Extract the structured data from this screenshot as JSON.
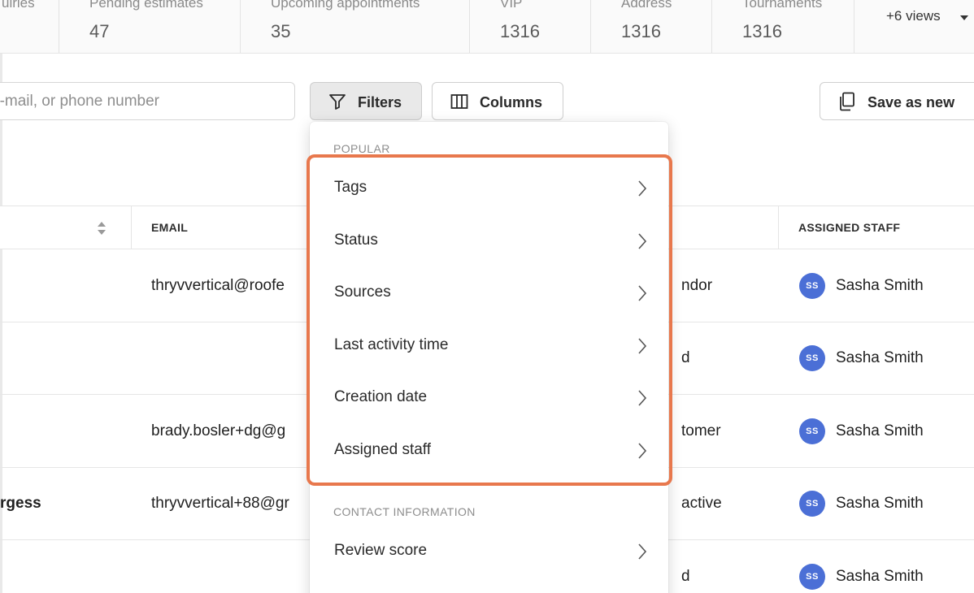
{
  "stats": [
    {
      "label": "uiries",
      "value": ""
    },
    {
      "label": "Pending estimates",
      "value": "47"
    },
    {
      "label": "Upcoming appointments",
      "value": "35"
    },
    {
      "label": "VIP",
      "value": "1316"
    },
    {
      "label": "Address",
      "value": "1316"
    },
    {
      "label": "Tournaments",
      "value": "1316"
    }
  ],
  "views_label": "+6 views",
  "toolbar": {
    "search_placeholder": "e-mail, or phone number",
    "filters_label": "Filters",
    "columns_label": "Columns",
    "save_label": "Save as new"
  },
  "table": {
    "headers": {
      "email": "EMAIL",
      "staff": "ASSIGNED STAFF"
    },
    "rows": [
      {
        "name": "",
        "email": "thryvvertical@roofe",
        "status": "ndor",
        "avatar": "SS",
        "staff": "Sasha Smith"
      },
      {
        "name": "",
        "email": "",
        "status": "d",
        "avatar": "SS",
        "staff": "Sasha Smith"
      },
      {
        "name": "",
        "email": "brady.bosler+dg@g",
        "status": "tomer",
        "avatar": "SS",
        "staff": "Sasha Smith"
      },
      {
        "name": "rgess",
        "email": "thryvvertical+88@gr",
        "status": "active",
        "avatar": "SS",
        "staff": "Sasha Smith"
      },
      {
        "name": "",
        "email": "",
        "status": "d",
        "avatar": "SS",
        "staff": "Sasha Smith"
      }
    ]
  },
  "filter_menu": {
    "popular_label": "POPULAR",
    "popular_items": [
      "Tags",
      "Status",
      "Sources",
      "Last activity time",
      "Creation date",
      "Assigned staff"
    ],
    "contact_label": "CONTACT INFORMATION",
    "contact_items": [
      "Review score"
    ]
  },
  "colors": {
    "highlight": "#e8784d",
    "avatar": "#4b6fd6"
  }
}
